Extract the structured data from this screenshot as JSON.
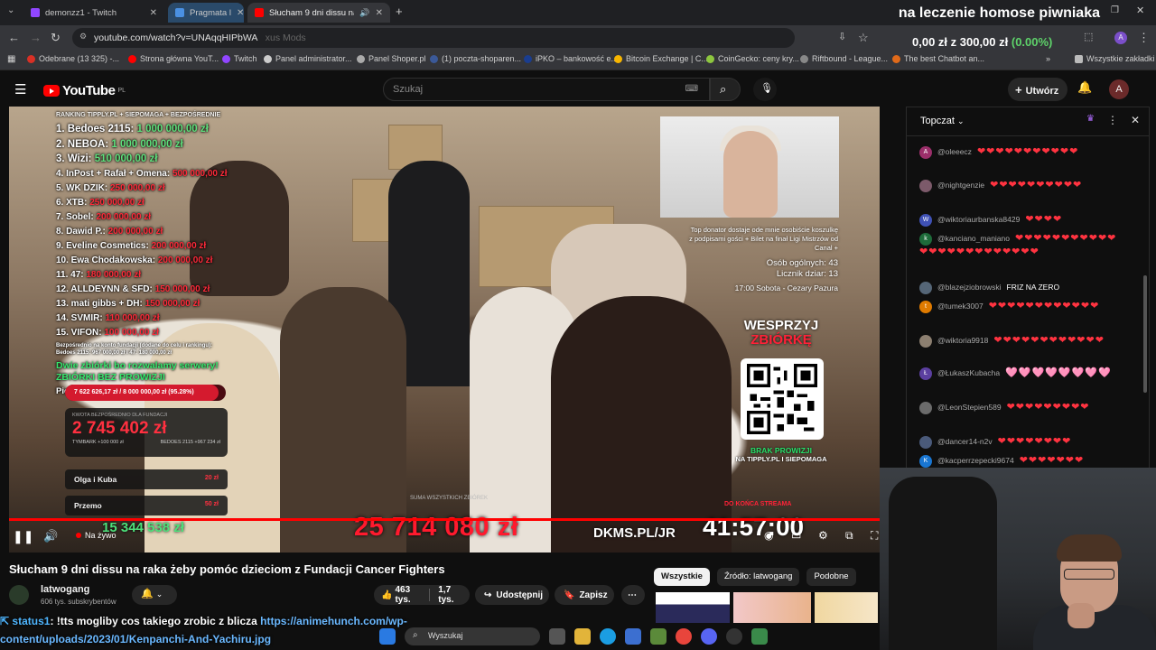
{
  "overlay": {
    "title": "na leczenie homose piwniaka",
    "money": "0,00 zł z 300,00 zł",
    "money_pct": "(0.00%)"
  },
  "browser": {
    "tabs": [
      {
        "label": "demonzz1 - Twitch",
        "favicon_color": "#9146ff"
      },
      {
        "label": "Pragmata l",
        "favicon_color": "#4a90e2"
      },
      {
        "label": "Słucham 9 dni dissu na raka",
        "favicon_color": "#ff0000"
      }
    ],
    "url": "youtube.com/watch?v=UNAqqHIPbWA",
    "url_ghost": "xus Mods",
    "bookmarks": [
      {
        "label": "Odebrane (13 325) -...",
        "color": "#d93025"
      },
      {
        "label": "Strona główna YouT...",
        "color": "#ff0000"
      },
      {
        "label": "Twitch",
        "color": "#9146ff"
      },
      {
        "label": "Panel administrator...",
        "color": "#cccccc"
      },
      {
        "label": "Panel Shoper.pl",
        "color": "#aaaaaa"
      },
      {
        "label": "(1) poczta-shoparen...",
        "color": "#3b5998"
      },
      {
        "label": "iPKO – bankowość e...",
        "color": "#1a3d8f"
      },
      {
        "label": "Bitcoin Exchange | C...",
        "color": "#f7b500"
      },
      {
        "label": "CoinGecko: ceny kry...",
        "color": "#8dc63f"
      },
      {
        "label": "Riftbound - League...",
        "color": "#888888"
      },
      {
        "label": "The best Chatbot an...",
        "color": "#e06a1a"
      },
      {
        "label": "Wszystkie zakładki",
        "color": "#bbbbbb"
      }
    ]
  },
  "youtube": {
    "logo": "YouTube",
    "region": "PL",
    "search_placeholder": "Szukaj",
    "create_label": "Utwórz",
    "avatar_letter": "A"
  },
  "stream": {
    "ranking_header": "RANKING TIPPLY.PL + SIEPOMAGA + BEZPOŚREDNIE",
    "ranking": [
      {
        "name": "1. Bedoes 2115:",
        "value": "1 000 000,00 zł"
      },
      {
        "name": "2. NEBOA:",
        "value": "1 000 000,00 zł"
      },
      {
        "name": "3. Wizi:",
        "value": "510 000,00 zł"
      },
      {
        "name": "4. InPost + Rafał + Omena:",
        "value": "500 000,00 zł"
      },
      {
        "name": "5. WK DZIK:",
        "value": "250 000,00 zł"
      },
      {
        "name": "6. XTB:",
        "value": "250 000,00 zł"
      },
      {
        "name": "7. Sobel:",
        "value": "200 000,00 zł"
      },
      {
        "name": "8. Dawid P.:",
        "value": "200 000,00 zł"
      },
      {
        "name": "9. Eveline Cosmetics:",
        "value": "200 000,00 zł"
      },
      {
        "name": "10. Ewa Chodakowska:",
        "value": "200 000,00 zł"
      },
      {
        "name": "11. 47:",
        "value": "180 000,00 zł"
      },
      {
        "name": "12. ALLDEYNN & SFD:",
        "value": "150 000,00 zł"
      },
      {
        "name": "13. mati gibbs + DH:",
        "value": "150 000,00 zł"
      },
      {
        "name": "14. SVMIR:",
        "value": "110 000,00 zł"
      },
      {
        "name": "15. VIFON:",
        "value": "100 000,00 zł"
      }
    ],
    "ranking_note": "Bezpośrednio na konto fundacji (dodane do celu i rankingu): Bedoes 2115: 967 000,00 zł i 47: 180 000,00 zł",
    "servers_line1": "Dwie zbiórki bo rozwalamy serwery!",
    "servers_line2": "ZBIÓRKI BEZ PROWIZJI",
    "fund_line": "Pieniądze na Fundacje Cancer Fighters",
    "progress_text": "7 622 626,17 zł / 8 000 000,00 zł (95.28%)",
    "progress_fraction": 0.9528,
    "direct_label": "KWOTA BEZPOŚREDNIO DLA FUNDACJI",
    "direct_amount": "2 745 402 zł",
    "direct_sub_left": "TYMBARK +100 000 zł",
    "direct_sub_right": "BEDOES 2115 +967 234 zł",
    "donors": [
      {
        "name": "Olga i Kuba",
        "amount": "20 zł"
      },
      {
        "name": "Przemo",
        "amount": "50 zł"
      }
    ],
    "top_donor_text": "Top donator dostaje ode mnie osobiście koszulkę z podpisami gości + Bilet na finał Ligi Mistrzów od Canal +",
    "people_total": "Osób ogólnych: 43",
    "shots_counter": "Licznik dziar: 13",
    "schedule": "17:00 Sobota - Cezary Pazura",
    "support_line1": "WESPRZYJ",
    "support_line2": "ZBIÓRKĘ",
    "no_fee_line1": "BRAK PROWIZJI",
    "no_fee_line2": "NA TIPPLY.PL I SIEPOMAGA",
    "sum_label": "SUMA WSZYSTKICH ZBIÓREK",
    "until_end": "DO KOŃCA STREAMA",
    "total": "25 714 080 zł",
    "dkms": "DKMS.PL/JR",
    "timer": "41:57:00",
    "ticker_amount": "15 344 538 zł"
  },
  "player": {
    "live_label": "Na żywo",
    "progress": 1.0
  },
  "video": {
    "title": "Słucham 9 dni dissu na raka żeby pomóc dzieciom z Fundacji Cancer Fighters",
    "channel": "latwogang",
    "subscribers": "606 tys. subskrybentów",
    "likes": "463 tys.",
    "dislikes_or_count": "1,7 tys.",
    "share_label": "Udostępnij",
    "save_label": "Zapisz",
    "chips": [
      "Wszystkie",
      "Źródło: latwogang",
      "Podobne"
    ]
  },
  "chat": {
    "title": "Topczat",
    "messages": [
      {
        "user": "@oleeecz",
        "text": "❤❤❤❤❤❤❤❤❤❤❤",
        "av": "A",
        "av_color": "#9b2f6a"
      },
      {
        "user": "@nightgenzie",
        "text": "❤❤❤❤❤❤❤❤❤❤",
        "av": "",
        "av_color": "#7c5a6a"
      },
      {
        "user": "@wiktoriaurbanska8429",
        "text": "❤❤❤❤",
        "av": "W",
        "av_color": "#3f51b5"
      },
      {
        "user": "@kanciano_maniano",
        "text": "❤❤❤❤❤❤❤❤❤❤❤❤❤❤❤❤❤❤❤❤❤❤❤❤",
        "av": "k",
        "av_color": "#1e6b3a"
      },
      {
        "user": "@blazejziobrowski",
        "text": "FRIZ NA ZERO",
        "av": "",
        "av_color": "#556677",
        "plain": true
      },
      {
        "user": "@tumek3007",
        "text": "❤❤❤❤❤❤❤❤❤❤❤❤",
        "av": "t",
        "av_color": "#e07b00"
      },
      {
        "user": "@wiktoria9918",
        "text": "❤❤❤❤❤❤❤❤❤❤❤❤",
        "av": "",
        "av_color": "#8c7f70"
      },
      {
        "user": "@ŁukaszKubacha",
        "text": "🩷🩷🩷🩷🩷🩷🩷🩷",
        "av": "Ł",
        "av_color": "#5b3fa0",
        "pink": true
      },
      {
        "user": "@LeonStepien589",
        "text": "❤❤❤❤❤❤❤❤❤",
        "av": "",
        "av_color": "#6b6b6b"
      },
      {
        "user": "@dancer14-n2v",
        "text": "❤❤❤❤❤❤❤❤",
        "av": "",
        "av_color": "#4a5a7a"
      },
      {
        "user": "@kacperrzepecki9674",
        "text": "❤❤❤❤❤❤❤",
        "av": "K",
        "av_color": "#1976d2"
      }
    ]
  },
  "bottom": {
    "user": "status1",
    "message": ": !tts mogliby cos takiego zrobic z blicza",
    "link1": "https://animehunch.com/wp-",
    "link2": "content/uploads/2023/01/Kenpanchi-And-Yachiru.jpg",
    "taskbar_search": "Wyszukaj"
  }
}
